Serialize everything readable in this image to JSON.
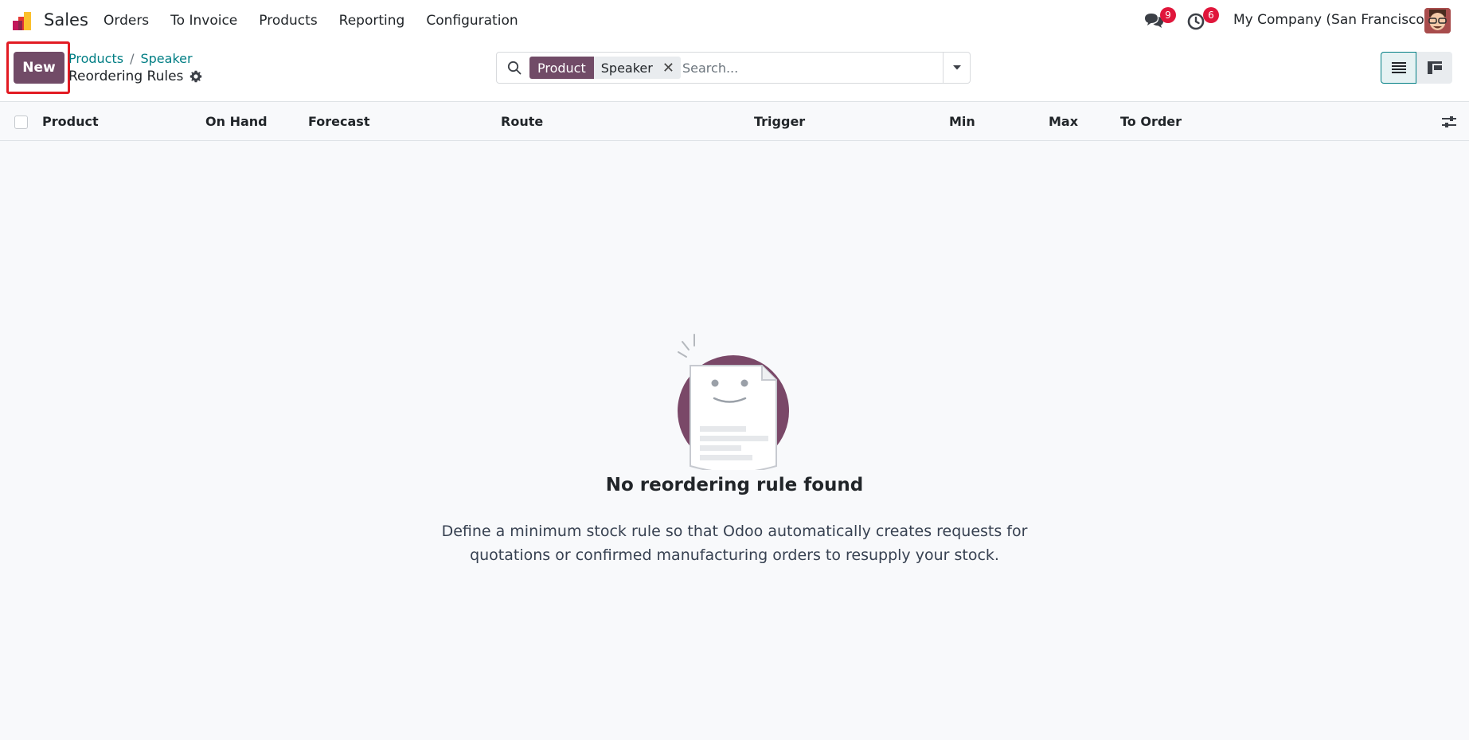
{
  "navbar": {
    "app_name": "Sales",
    "menu": [
      "Orders",
      "To Invoice",
      "Products",
      "Reporting",
      "Configuration"
    ],
    "messages_count": "9",
    "activities_count": "6",
    "company": "My Company (San Francisco)",
    "icons": {
      "app": "odoo-sales-app-icon",
      "messages": "chat-icon",
      "activities": "clock-icon",
      "avatar": "user-avatar"
    }
  },
  "control_panel": {
    "new_label": "New",
    "breadcrumb": [
      "Products",
      "Speaker"
    ],
    "breadcrumb_separator": "/",
    "title": "Reordering Rules",
    "search": {
      "facet_label": "Product",
      "facet_value": "Speaker",
      "facet_close": "✕",
      "placeholder": "Search..."
    },
    "views": [
      "list",
      "kanban"
    ],
    "active_view": "list"
  },
  "list": {
    "columns": [
      "Product",
      "On Hand",
      "Forecast",
      "Route",
      "Trigger",
      "Min",
      "Max",
      "To Order"
    ]
  },
  "empty_state": {
    "title": "No reordering rule found",
    "text_line1": "Define a minimum stock rule so that Odoo automatically creates requests for",
    "text_line2": "quotations or confirmed manufacturing orders to resupply your stock."
  },
  "colors": {
    "brand": "#714b67",
    "link": "#017e84",
    "badge": "#e0163b",
    "highlight": "#e21b23"
  }
}
